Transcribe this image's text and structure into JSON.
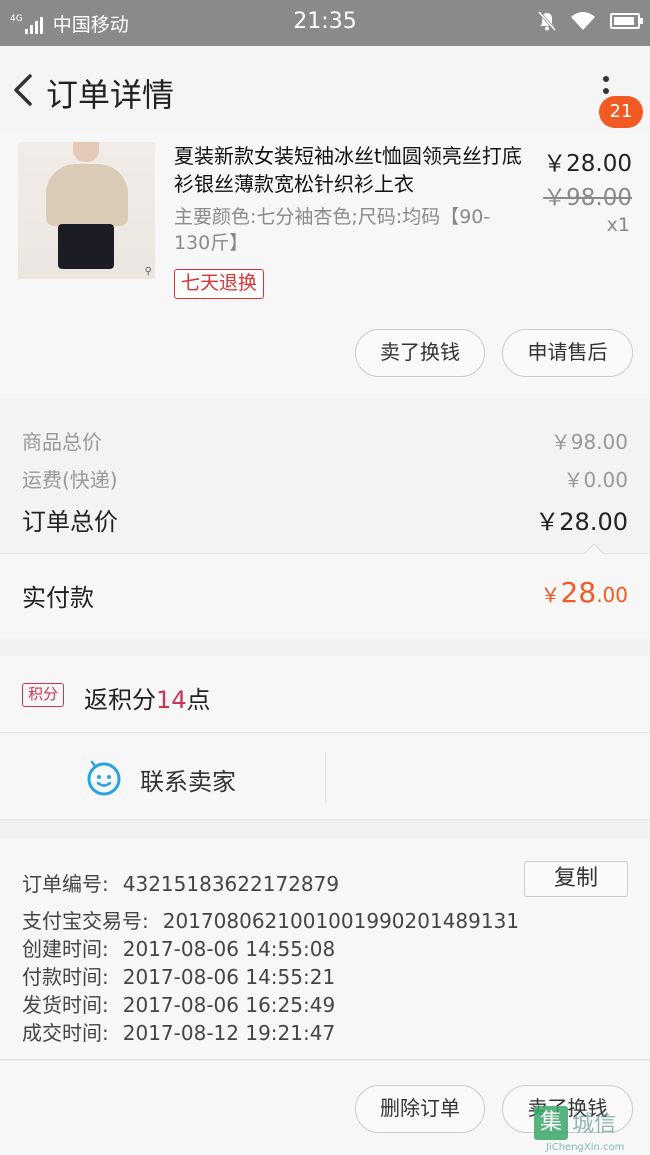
{
  "status_bar": {
    "network": "4G",
    "carrier": "中国移动",
    "time": "21:35",
    "icons": [
      "signal-icon",
      "mute-bell-icon",
      "wifi-icon",
      "battery-icon"
    ]
  },
  "header": {
    "title": "订单详情",
    "badge_count": "21",
    "icons": [
      "back-icon",
      "more-icon"
    ]
  },
  "product": {
    "name": "夏装新款女装短袖冰丝t恤圆领亮丝打底衫银丝薄款宽松针织衫上衣",
    "spec": "主要颜色:七分袖杏色;尺码:均码【90-130斤】",
    "tag": "七天退换",
    "price": "￥28.00",
    "original_price": "￥98.00",
    "quantity": "x1",
    "thumb_icon": "zoom-icon",
    "zoom_glyph": "⚲",
    "buttons": {
      "sell": "卖了换钱",
      "after_sale": "申请售后"
    }
  },
  "totals": {
    "goods_label": "商品总价",
    "goods_value": "￥98.00",
    "shipping_label": "运费(快递)",
    "shipping_value": "￥0.00",
    "order_total_label": "订单总价",
    "order_total_value": "￥28.00",
    "paid_label": "实付款",
    "paid_currency": "￥",
    "paid_int": "28",
    "paid_dec": ".00",
    "accent_color": "#f15a22"
  },
  "points": {
    "tag": "积分",
    "text_prefix": "返积分",
    "count": "14",
    "text_suffix": "点"
  },
  "contact": {
    "label": "联系卖家",
    "icon": "chat-face-icon"
  },
  "order_info": {
    "order_no_label": "订单编号:",
    "order_no": "43215183622172879",
    "copy_label": "复制",
    "alipay_label": "支付宝交易号:",
    "alipay_no": "2017080621001001990201489131",
    "created_label": "创建时间:",
    "created": "2017-08-06 14:55:08",
    "paid_label": "付款时间:",
    "paid": "2017-08-06 14:55:21",
    "shipped_label": "发货时间:",
    "shipped": "2017-08-06 16:25:49",
    "completed_label": "成交时间:",
    "completed": "2017-08-12 19:21:47"
  },
  "bottom_bar": {
    "delete_label": "删除订单",
    "sell_label": "卖了换钱"
  },
  "watermark": {
    "logo": "集",
    "brand": "城信",
    "url": "JiChengXin.com"
  }
}
